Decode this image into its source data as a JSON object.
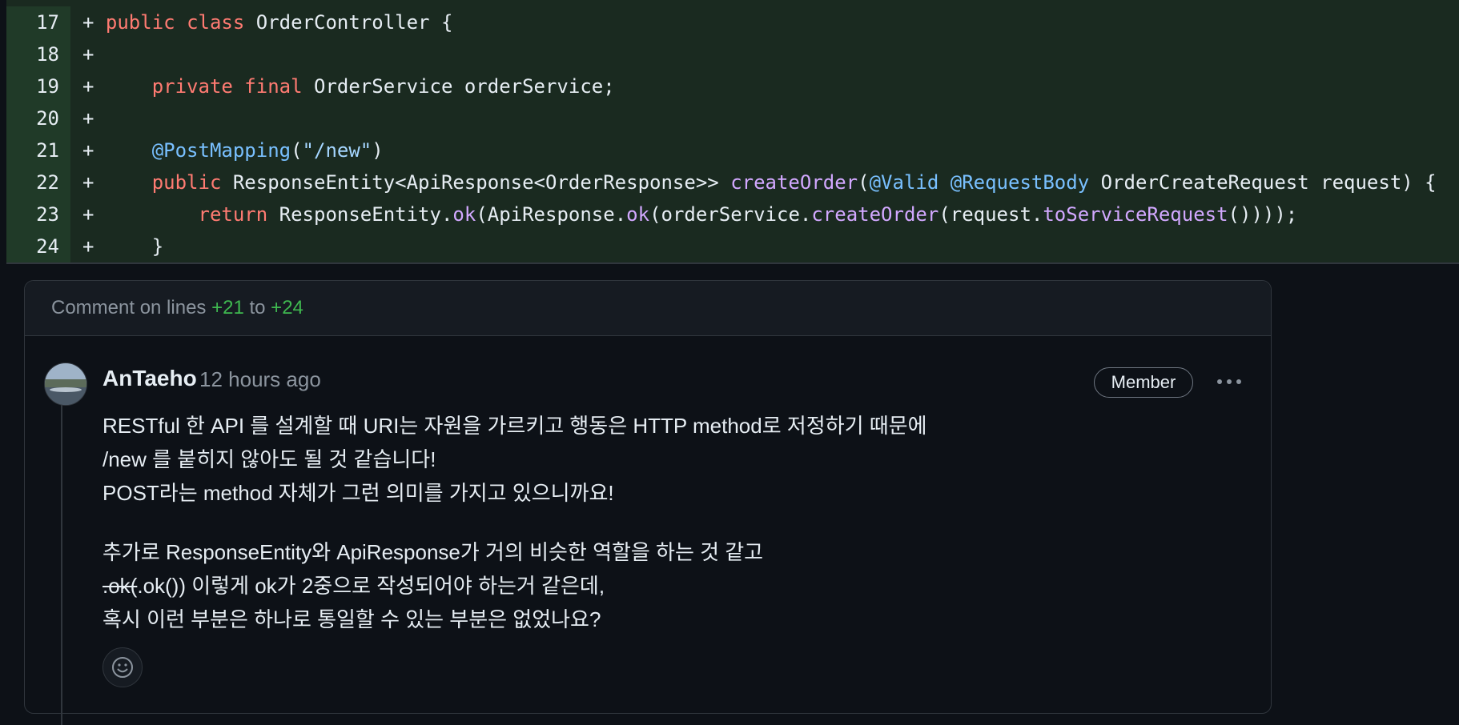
{
  "diff": {
    "lines": [
      {
        "num": "17",
        "marker": "+",
        "tokens": [
          [
            "k",
            "public "
          ],
          [
            "k",
            "class "
          ],
          [
            "",
            "OrderController {"
          ]
        ]
      },
      {
        "num": "18",
        "marker": "+",
        "tokens": []
      },
      {
        "num": "19",
        "marker": "+",
        "tokens": [
          [
            "",
            "    "
          ],
          [
            "k",
            "private "
          ],
          [
            "k",
            "final "
          ],
          [
            "",
            "OrderService orderService;"
          ]
        ]
      },
      {
        "num": "20",
        "marker": "+",
        "tokens": []
      },
      {
        "num": "21",
        "marker": "+",
        "tokens": [
          [
            "",
            "    "
          ],
          [
            "a",
            "@PostMapping"
          ],
          [
            "",
            "("
          ],
          [
            "s",
            "\"/new\""
          ],
          [
            "",
            ")"
          ]
        ]
      },
      {
        "num": "22",
        "marker": "+",
        "tokens": [
          [
            "",
            "    "
          ],
          [
            "k",
            "public "
          ],
          [
            "",
            "ResponseEntity<ApiResponse<OrderResponse>> "
          ],
          [
            "f",
            "createOrder"
          ],
          [
            "",
            "("
          ],
          [
            "a",
            "@Valid "
          ],
          [
            "a",
            "@RequestBody "
          ],
          [
            "",
            "OrderCreateRequest request) {"
          ]
        ]
      },
      {
        "num": "23",
        "marker": "+",
        "tokens": [
          [
            "",
            "        "
          ],
          [
            "k",
            "return "
          ],
          [
            "",
            "ResponseEntity."
          ],
          [
            "f",
            "ok"
          ],
          [
            "",
            "(ApiResponse."
          ],
          [
            "f",
            "ok"
          ],
          [
            "",
            "(orderService."
          ],
          [
            "f",
            "createOrder"
          ],
          [
            "",
            "(request."
          ],
          [
            "f",
            "toServiceRequest"
          ],
          [
            "",
            "())));"
          ]
        ]
      },
      {
        "num": "24",
        "marker": "+",
        "tokens": [
          [
            "",
            "    }"
          ]
        ]
      }
    ]
  },
  "thread": {
    "header_prefix": "Comment on lines ",
    "range_start": "+21",
    "range_sep": " to ",
    "range_end": "+24"
  },
  "comment": {
    "author": "AnTaeho",
    "time": "12 hours ago",
    "role_badge": "Member",
    "more_icon": "kebab-horizontal-icon",
    "paragraph1": [
      "RESTful 한 API 를 설계할 때 URI는 자원을 가르키고 행동은 HTTP method로 저정하기 때문에",
      "/new 를 붙히지 않아도 될 것 같습니다!",
      "POST라는 method 자체가 그런 의미를 가지고 있으니까요!"
    ],
    "paragraph2_line1": "추가로 ResponseEntity와 ApiResponse가 거의 비슷한 역할을 하는 것 같고",
    "paragraph2_line2_strike": ".ok(",
    "paragraph2_line2_rest": ".ok()) 이렇게 ok가 2중으로 작성되어야 하는거 같은데,",
    "paragraph2_line3": "혹시 이런 부분은 하나로 통일할 수 있는 부분은 없었나요?",
    "reaction_icon": "smiley-icon"
  },
  "colors": {
    "addition_bg": "#1a2a20",
    "line_number_bg": "#203a28",
    "keyword": "#ff7b72",
    "annotation": "#79c0ff",
    "string": "#a5d6ff",
    "method": "#d2a8ff",
    "added_range": "#3fb950"
  }
}
